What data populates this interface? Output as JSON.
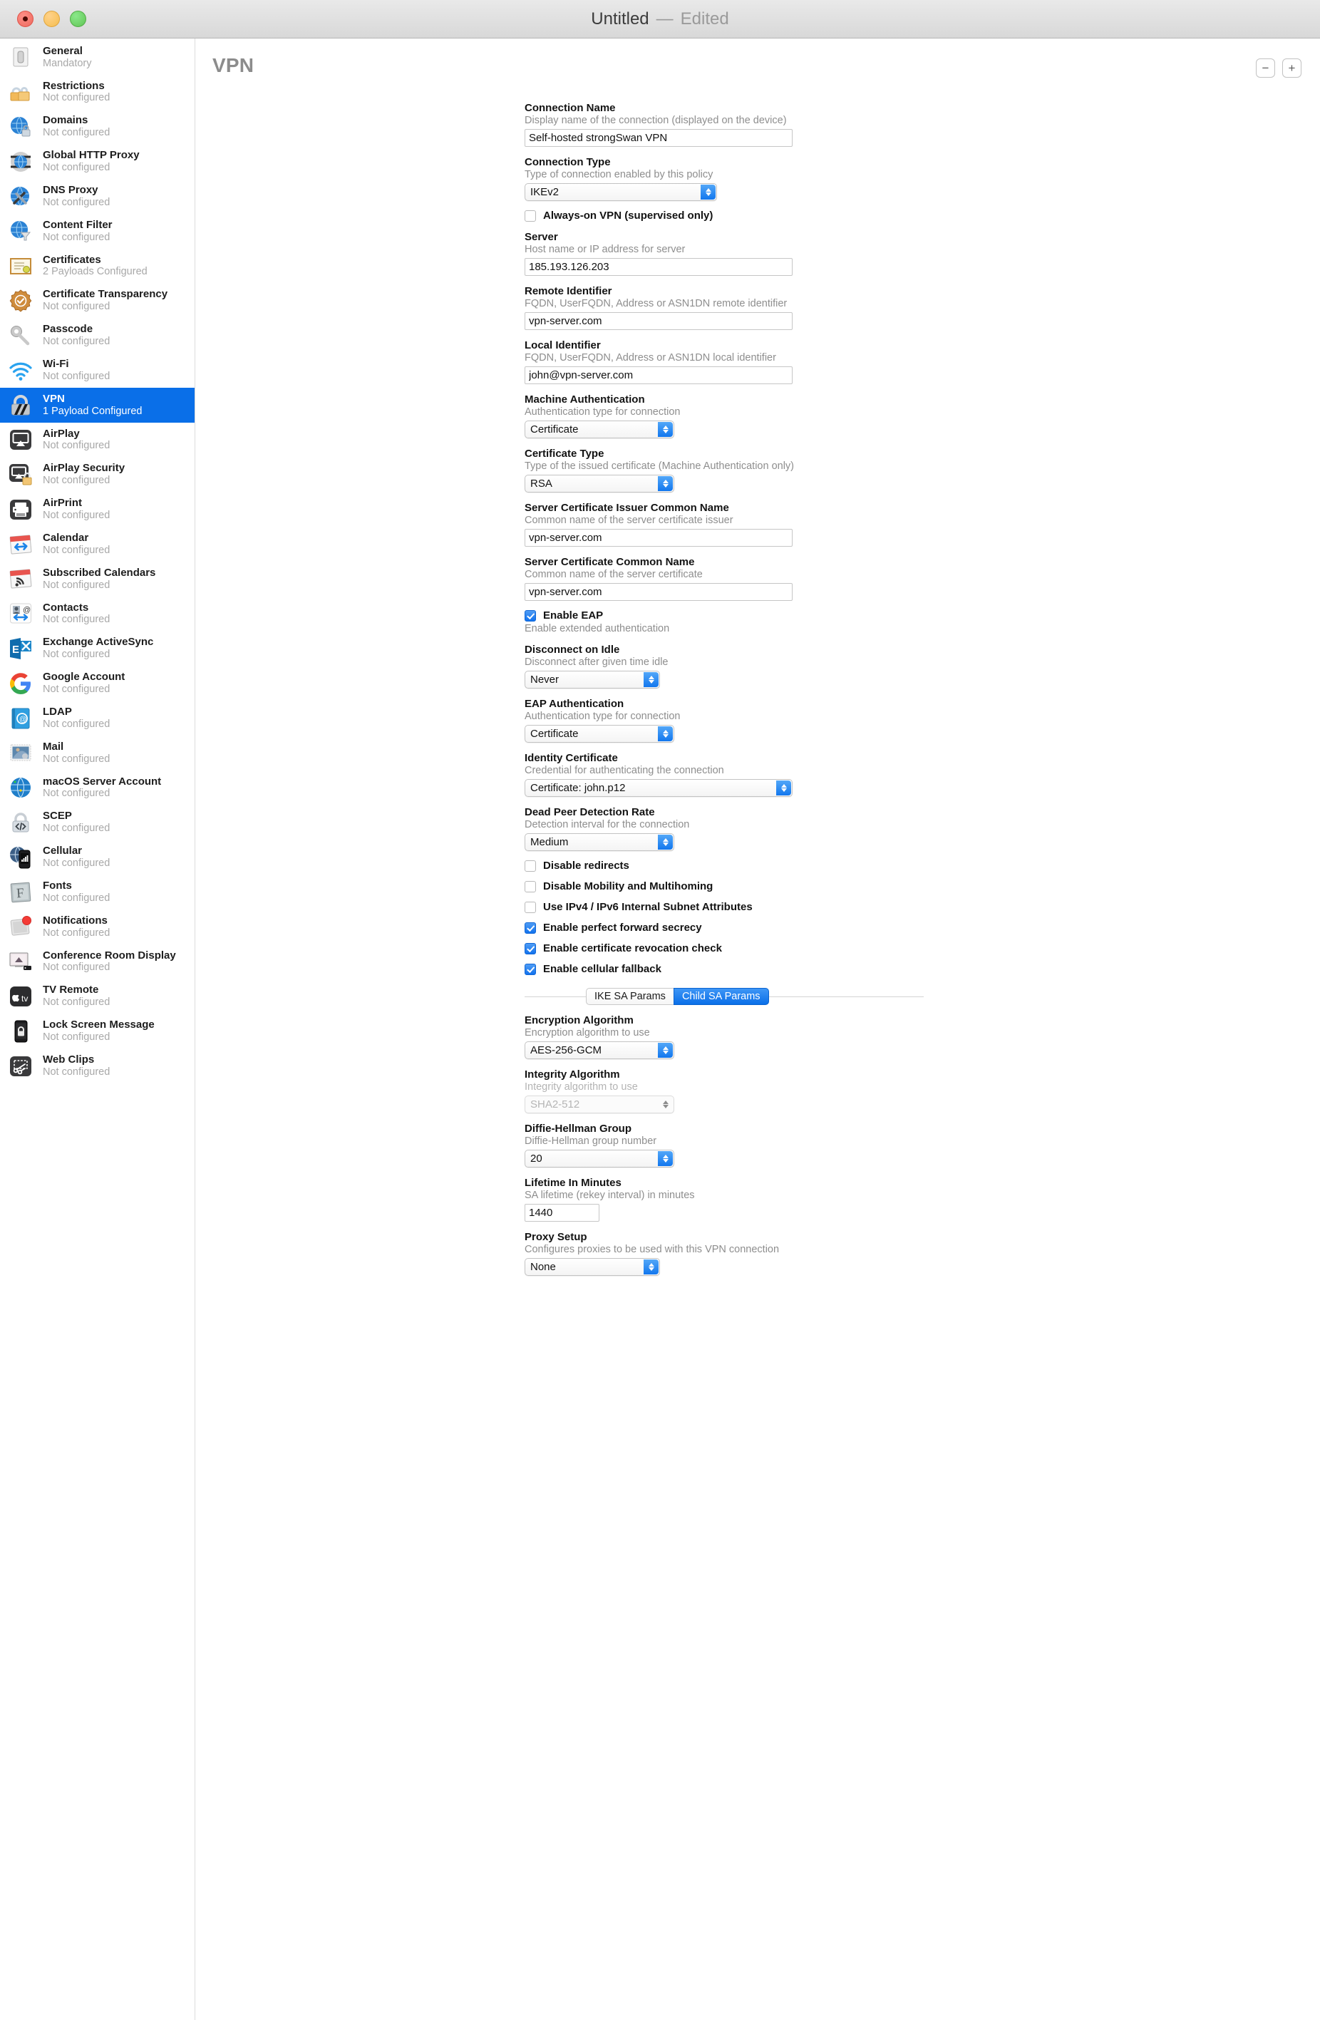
{
  "window": {
    "title": "Untitled",
    "dash": "—",
    "state": "Edited",
    "traffic": {
      "close": "close-button",
      "minimize": "minimize-button",
      "zoom": "zoom-button"
    }
  },
  "header": {
    "pane_title": "VPN",
    "remove_label": "−",
    "add_label": "+"
  },
  "sidebar": {
    "items": [
      {
        "icon": "general-switch-icon",
        "label": "General",
        "status": "Mandatory",
        "selected": false
      },
      {
        "icon": "restrictions-locks-icon",
        "label": "Restrictions",
        "status": "Not configured",
        "selected": false
      },
      {
        "icon": "domains-globe-lock-icon",
        "label": "Domains",
        "status": "Not configured",
        "selected": false
      },
      {
        "icon": "global-http-proxy-icon",
        "label": "Global HTTP Proxy",
        "status": "Not configured",
        "selected": false
      },
      {
        "icon": "dns-proxy-icon",
        "label": "DNS Proxy",
        "status": "Not configured",
        "selected": false
      },
      {
        "icon": "content-filter-icon",
        "label": "Content Filter",
        "status": "Not configured",
        "selected": false
      },
      {
        "icon": "certificates-icon",
        "label": "Certificates",
        "status": "2 Payloads Configured",
        "selected": false
      },
      {
        "icon": "certificate-transparency-icon",
        "label": "Certificate Transparency",
        "status": "Not configured",
        "selected": false
      },
      {
        "icon": "passcode-key-icon",
        "label": "Passcode",
        "status": "Not configured",
        "selected": false
      },
      {
        "icon": "wifi-icon",
        "label": "Wi-Fi",
        "status": "Not configured",
        "selected": false
      },
      {
        "icon": "vpn-lock-icon",
        "label": "VPN",
        "status": "1 Payload Configured",
        "selected": true
      },
      {
        "icon": "airplay-icon",
        "label": "AirPlay",
        "status": "Not configured",
        "selected": false
      },
      {
        "icon": "airplay-security-icon",
        "label": "AirPlay Security",
        "status": "Not configured",
        "selected": false
      },
      {
        "icon": "airprint-icon",
        "label": "AirPrint",
        "status": "Not configured",
        "selected": false
      },
      {
        "icon": "calendar-icon",
        "label": "Calendar",
        "status": "Not configured",
        "selected": false
      },
      {
        "icon": "subscribed-calendars-icon",
        "label": "Subscribed Calendars",
        "status": "Not configured",
        "selected": false
      },
      {
        "icon": "contacts-icon",
        "label": "Contacts",
        "status": "Not configured",
        "selected": false
      },
      {
        "icon": "exchange-activesync-icon",
        "label": "Exchange ActiveSync",
        "status": "Not configured",
        "selected": false
      },
      {
        "icon": "google-account-icon",
        "label": "Google Account",
        "status": "Not configured",
        "selected": false
      },
      {
        "icon": "ldap-icon",
        "label": "LDAP",
        "status": "Not configured",
        "selected": false
      },
      {
        "icon": "mail-icon",
        "label": "Mail",
        "status": "Not configured",
        "selected": false
      },
      {
        "icon": "macos-server-account-icon",
        "label": "macOS Server Account",
        "status": "Not configured",
        "selected": false
      },
      {
        "icon": "scep-icon",
        "label": "SCEP",
        "status": "Not configured",
        "selected": false
      },
      {
        "icon": "cellular-icon",
        "label": "Cellular",
        "status": "Not configured",
        "selected": false
      },
      {
        "icon": "fonts-icon",
        "label": "Fonts",
        "status": "Not configured",
        "selected": false
      },
      {
        "icon": "notifications-icon",
        "label": "Notifications",
        "status": "Not configured",
        "selected": false
      },
      {
        "icon": "conference-room-display-icon",
        "label": "Conference Room Display",
        "status": "Not configured",
        "selected": false
      },
      {
        "icon": "tv-remote-icon",
        "label": "TV Remote",
        "status": "Not configured",
        "selected": false
      },
      {
        "icon": "lock-screen-message-icon",
        "label": "Lock Screen Message",
        "status": "Not configured",
        "selected": false
      },
      {
        "icon": "web-clips-icon",
        "label": "Web Clips",
        "status": "Not configured",
        "selected": false
      }
    ]
  },
  "form": {
    "connection_name": {
      "label": "Connection Name",
      "desc": "Display name of the connection (displayed on the device)",
      "value": "Self-hosted strongSwan VPN"
    },
    "connection_type": {
      "label": "Connection Type",
      "desc": "Type of connection enabled by this policy",
      "value": "IKEv2"
    },
    "always_on": {
      "label": "Always-on VPN (supervised only)",
      "checked": false
    },
    "server": {
      "label": "Server",
      "desc": "Host name or IP address for server",
      "value": "185.193.126.203"
    },
    "remote_identifier": {
      "label": "Remote Identifier",
      "desc": "FQDN, UserFQDN, Address or ASN1DN remote identifier",
      "value": "vpn-server.com"
    },
    "local_identifier": {
      "label": "Local Identifier",
      "desc": "FQDN, UserFQDN, Address or ASN1DN local identifier",
      "value": "john@vpn-server.com"
    },
    "machine_auth": {
      "label": "Machine Authentication",
      "desc": "Authentication type for connection",
      "value": "Certificate"
    },
    "certificate_type": {
      "label": "Certificate Type",
      "desc": "Type of the issued certificate (Machine Authentication only)",
      "value": "RSA"
    },
    "server_cert_issuer_cn": {
      "label": "Server Certificate Issuer Common Name",
      "desc": "Common name of the server certificate issuer",
      "value": "vpn-server.com"
    },
    "server_cert_cn": {
      "label": "Server Certificate Common Name",
      "desc": "Common name of the server certificate",
      "value": "vpn-server.com"
    },
    "enable_eap": {
      "label": "Enable EAP",
      "desc": "Enable extended authentication",
      "checked": true
    },
    "disconnect_on_idle": {
      "label": "Disconnect on Idle",
      "desc": "Disconnect after given time idle",
      "value": "Never"
    },
    "eap_auth": {
      "label": "EAP Authentication",
      "desc": "Authentication type for connection",
      "value": "Certificate"
    },
    "identity_certificate": {
      "label": "Identity Certificate",
      "desc": "Credential for authenticating the connection",
      "value": "Certificate: john.p12"
    },
    "dead_peer_detection": {
      "label": "Dead Peer Detection Rate",
      "desc": "Detection interval for the connection",
      "value": "Medium"
    },
    "disable_redirects": {
      "label": "Disable redirects",
      "checked": false
    },
    "disable_mobility": {
      "label": "Disable Mobility and Multihoming",
      "checked": false
    },
    "use_internal_subnet": {
      "label": "Use IPv4 / IPv6 Internal Subnet Attributes",
      "checked": false
    },
    "perfect_forward_secrecy": {
      "label": "Enable perfect forward secrecy",
      "checked": true
    },
    "cert_revocation_check": {
      "label": "Enable certificate revocation check",
      "checked": true
    },
    "cellular_fallback": {
      "label": "Enable cellular fallback",
      "checked": true
    },
    "sa_tabs": {
      "ike": "IKE SA Params",
      "child": "Child SA Params",
      "active": "Child SA Params"
    },
    "encryption_algorithm": {
      "label": "Encryption Algorithm",
      "desc": "Encryption algorithm to use",
      "value": "AES-256-GCM"
    },
    "integrity_algorithm": {
      "label": "Integrity Algorithm",
      "desc": "Integrity algorithm to use",
      "value": "SHA2-512",
      "disabled": true
    },
    "diffie_hellman_group": {
      "label": "Diffie-Hellman Group",
      "desc": "Diffie-Hellman group number",
      "value": "20"
    },
    "lifetime_in_minutes": {
      "label": "Lifetime In Minutes",
      "desc": "SA lifetime (rekey interval) in minutes",
      "value": "1440"
    },
    "proxy_setup": {
      "label": "Proxy Setup",
      "desc": "Configures proxies to be used with this VPN connection",
      "value": "None"
    }
  },
  "colors": {
    "accent": "#0a6fe8",
    "selection": "#0a6fe8",
    "label": "#131313",
    "description": "#8e8e8e",
    "disabled": "#b5b5b5"
  }
}
